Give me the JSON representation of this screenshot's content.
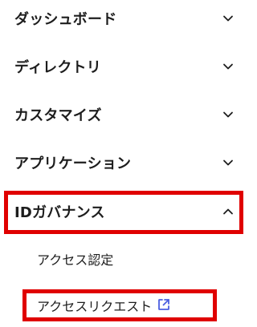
{
  "nav": {
    "sections": [
      {
        "label": "ダッシュボード",
        "expanded": false
      },
      {
        "label": "ディレクトリ",
        "expanded": false
      },
      {
        "label": "カスタマイズ",
        "expanded": false
      },
      {
        "label": "アプリケーション",
        "expanded": false
      },
      {
        "label": "IDガバナンス",
        "expanded": true
      }
    ],
    "sub_items": [
      {
        "label": "アクセス認定"
      },
      {
        "label": "アクセスリクエスト",
        "icon": "external-link-icon"
      }
    ]
  },
  "colors": {
    "highlight": "#e00000",
    "text": "#1d1d1d",
    "link_icon": "#4b5ee0"
  }
}
